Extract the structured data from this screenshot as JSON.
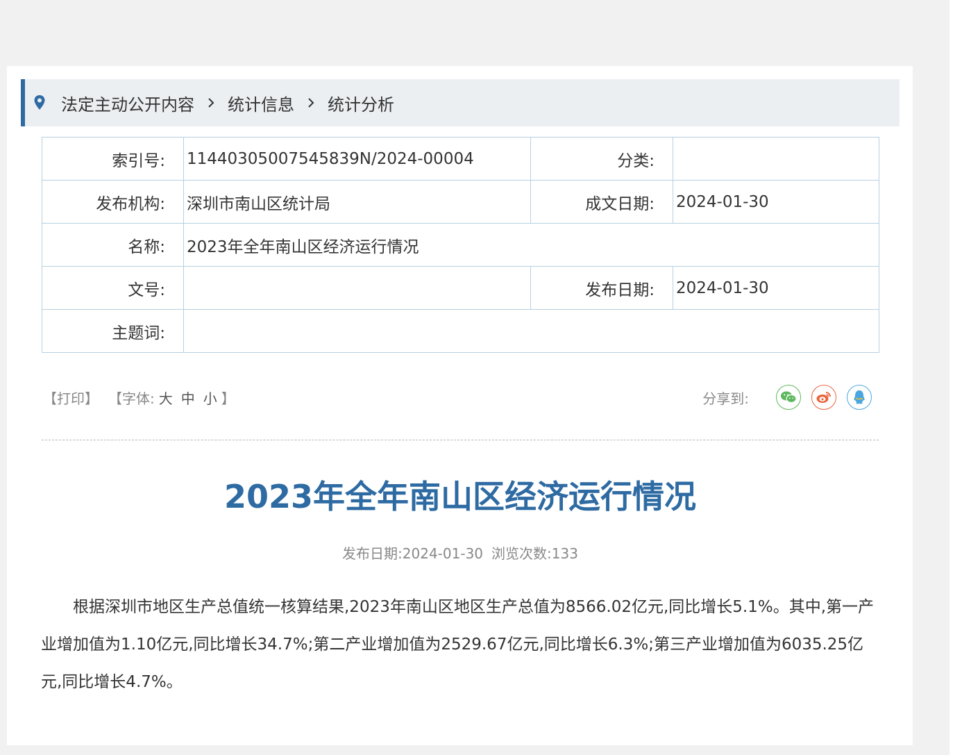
{
  "breadcrumb": {
    "items": [
      "法定主动公开内容",
      "统计信息",
      "统计分析"
    ]
  },
  "meta": {
    "index_label": "索引号:",
    "index_value": "11440305007545839N/2024-00004",
    "category_label": "分类:",
    "category_value": "",
    "publisher_label": "发布机构:",
    "publisher_value": "深圳市南山区统计局",
    "written_date_label": "成文日期:",
    "written_date_value": "2024-01-30",
    "name_label": "名称:",
    "name_value": "2023年全年南山区经济运行情况",
    "doc_no_label": "文号:",
    "doc_no_value": "",
    "publish_date_label": "发布日期:",
    "publish_date_value": "2024-01-30",
    "keywords_label": "主题词:",
    "keywords_value": ""
  },
  "tools": {
    "print": "【打印】",
    "font_prefix": "【字体:",
    "font_large": "大",
    "font_medium": "中",
    "font_small": "小",
    "font_suffix": "】",
    "share_label": "分享到:"
  },
  "share_icons": {
    "wechat_color": "#5cb85c",
    "weibo_color": "#e8643b",
    "qq_color": "#4aa6e0"
  },
  "article": {
    "title": "2023年全年南山区经济运行情况",
    "publish_date": "发布日期:2024-01-30",
    "views": "浏览次数:133",
    "paragraph": "根据深圳市地区生产总值统一核算结果,2023年南山区地区生产总值为8566.02亿元,同比增长5.1%。其中,第一产业增加值为1.10亿元,同比增长34.7%;第二产业增加值为2529.67亿元,同比增长6.3%;第三产业增加值为6035.25亿元,同比增长4.7%。"
  },
  "colors": {
    "accent": "#2e6ba3",
    "table_border": "#b7cfe0",
    "breadcrumb_bg": "#eceff2"
  }
}
